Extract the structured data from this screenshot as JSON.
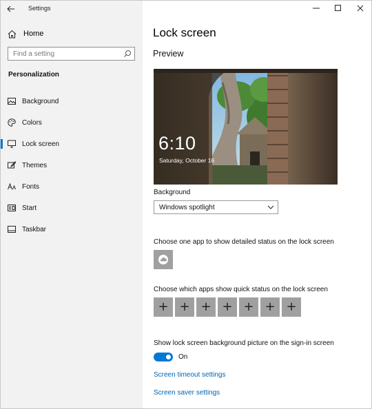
{
  "window": {
    "title": "Settings",
    "controls": [
      "minimize-icon",
      "maximize-icon",
      "close-icon"
    ]
  },
  "sidebar": {
    "home_label": "Home",
    "search_placeholder": "Find a setting",
    "section_title": "Personalization",
    "items": [
      {
        "label": "Background",
        "icon": "picture-icon",
        "selected": false
      },
      {
        "label": "Colors",
        "icon": "palette-icon",
        "selected": false
      },
      {
        "label": "Lock screen",
        "icon": "monitor-lock-icon",
        "selected": true
      },
      {
        "label": "Themes",
        "icon": "brush-icon",
        "selected": false
      },
      {
        "label": "Fonts",
        "icon": "fonts-icon",
        "selected": false
      },
      {
        "label": "Start",
        "icon": "start-icon",
        "selected": false
      },
      {
        "label": "Taskbar",
        "icon": "taskbar-icon",
        "selected": false
      }
    ]
  },
  "main": {
    "title": "Lock screen",
    "preview_heading": "Preview",
    "preview": {
      "time": "6:10",
      "date": "Saturday, October 16"
    },
    "background_label": "Background",
    "background_value": "Windows spotlight",
    "detail_status_label": "Choose one app to show detailed status on the lock screen",
    "detail_status_app_icon": "weather-icon",
    "quick_status_label": "Choose which apps show quick status on the lock screen",
    "quick_status_slots": [
      "+",
      "+",
      "+",
      "+",
      "+",
      "+",
      "+"
    ],
    "show_background_label": "Show lock screen background picture on the sign-in screen",
    "show_background_toggle": "On",
    "links": {
      "timeout": "Screen timeout settings",
      "saver": "Screen saver settings"
    },
    "accent_color": "#0078d7",
    "link_color": "#0063b1"
  }
}
